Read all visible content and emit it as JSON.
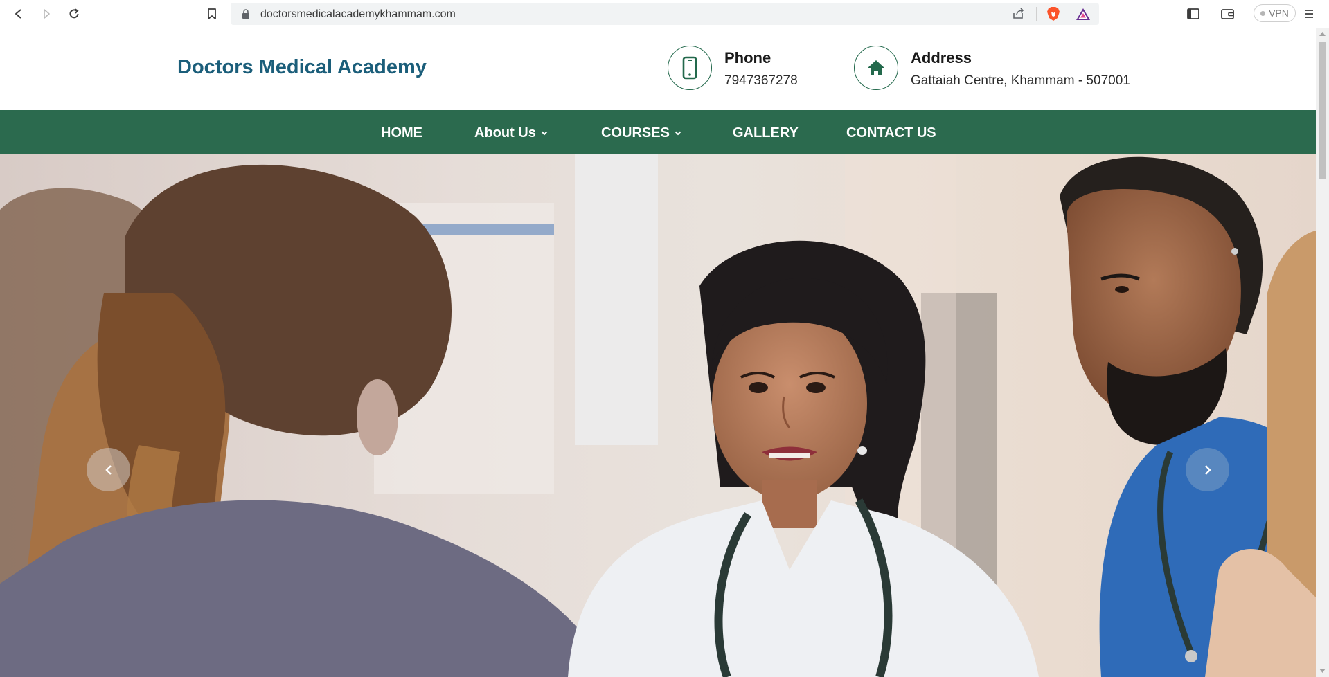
{
  "browser": {
    "url": "doctorsmedicalacademykhammam.com",
    "vpn_label": "VPN"
  },
  "header": {
    "brand": "Doctors Medical Academy",
    "phone": {
      "title": "Phone",
      "value": "7947367278",
      "icon": "phone-icon"
    },
    "address": {
      "title": "Address",
      "value": "Gattaiah Centre, Khammam - 507001",
      "icon": "home-icon"
    }
  },
  "nav": {
    "items": [
      {
        "label": "HOME"
      },
      {
        "label": "About Us"
      },
      {
        "label": "COURSES"
      },
      {
        "label": "GALLERY"
      },
      {
        "label": "CONTACT US"
      }
    ]
  },
  "hero": {
    "prev_icon": "chevron-left-icon",
    "next_icon": "chevron-right-icon"
  },
  "colors": {
    "brand": "#1b5e7a",
    "nav_bg": "#2b6a4e",
    "icon_green": "#23694c"
  }
}
